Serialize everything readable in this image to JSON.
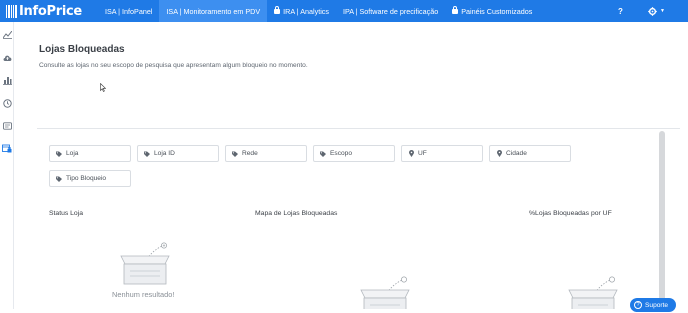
{
  "brand": {
    "name": "InfoPrice"
  },
  "nav": {
    "items": [
      {
        "label": "ISA | InfoPanel",
        "locked": false,
        "active": false
      },
      {
        "label": "ISA | Monitoramento em PDV",
        "locked": false,
        "active": true
      },
      {
        "label": "IRA | Analytics",
        "locked": true,
        "active": false
      },
      {
        "label": "IPA | Software de precificação",
        "locked": false,
        "active": false
      },
      {
        "label": "Painéis Customizados",
        "locked": true,
        "active": false
      }
    ],
    "help_label": "?",
    "settings_icon": "gear-icon"
  },
  "sidebar": {
    "icons": [
      "chart-line-icon",
      "cloud-upload-icon",
      "bar-chart-icon",
      "clock-icon",
      "id-card-icon",
      "store-lock-icon"
    ]
  },
  "page": {
    "title": "Lojas Bloqueadas",
    "subtitle": "Consulte as lojas no seu escopo de pesquisa que apresentam algum bloqueio no momento."
  },
  "filters": [
    {
      "label": "Loja",
      "icon": "tag-icon"
    },
    {
      "label": "Loja ID",
      "icon": "tag-icon"
    },
    {
      "label": "Rede",
      "icon": "tag-icon"
    },
    {
      "label": "Escopo",
      "icon": "tag-icon"
    },
    {
      "label": "UF",
      "icon": "map-marker-icon"
    },
    {
      "label": "Cidade",
      "icon": "map-marker-icon"
    },
    {
      "label": "Tipo Bloqueio",
      "icon": "tag-icon"
    }
  ],
  "sections": {
    "status": "Status Loja",
    "map": "Mapa de Lojas Bloqueadas",
    "percent": "%Lojas Bloqueadas por UF"
  },
  "empty_state": {
    "message": "Nenhum resultado!"
  },
  "support": {
    "label": "Suporte"
  },
  "colors": {
    "topbar": "#1f7ae6",
    "active_tab": "#3d8ff0"
  }
}
